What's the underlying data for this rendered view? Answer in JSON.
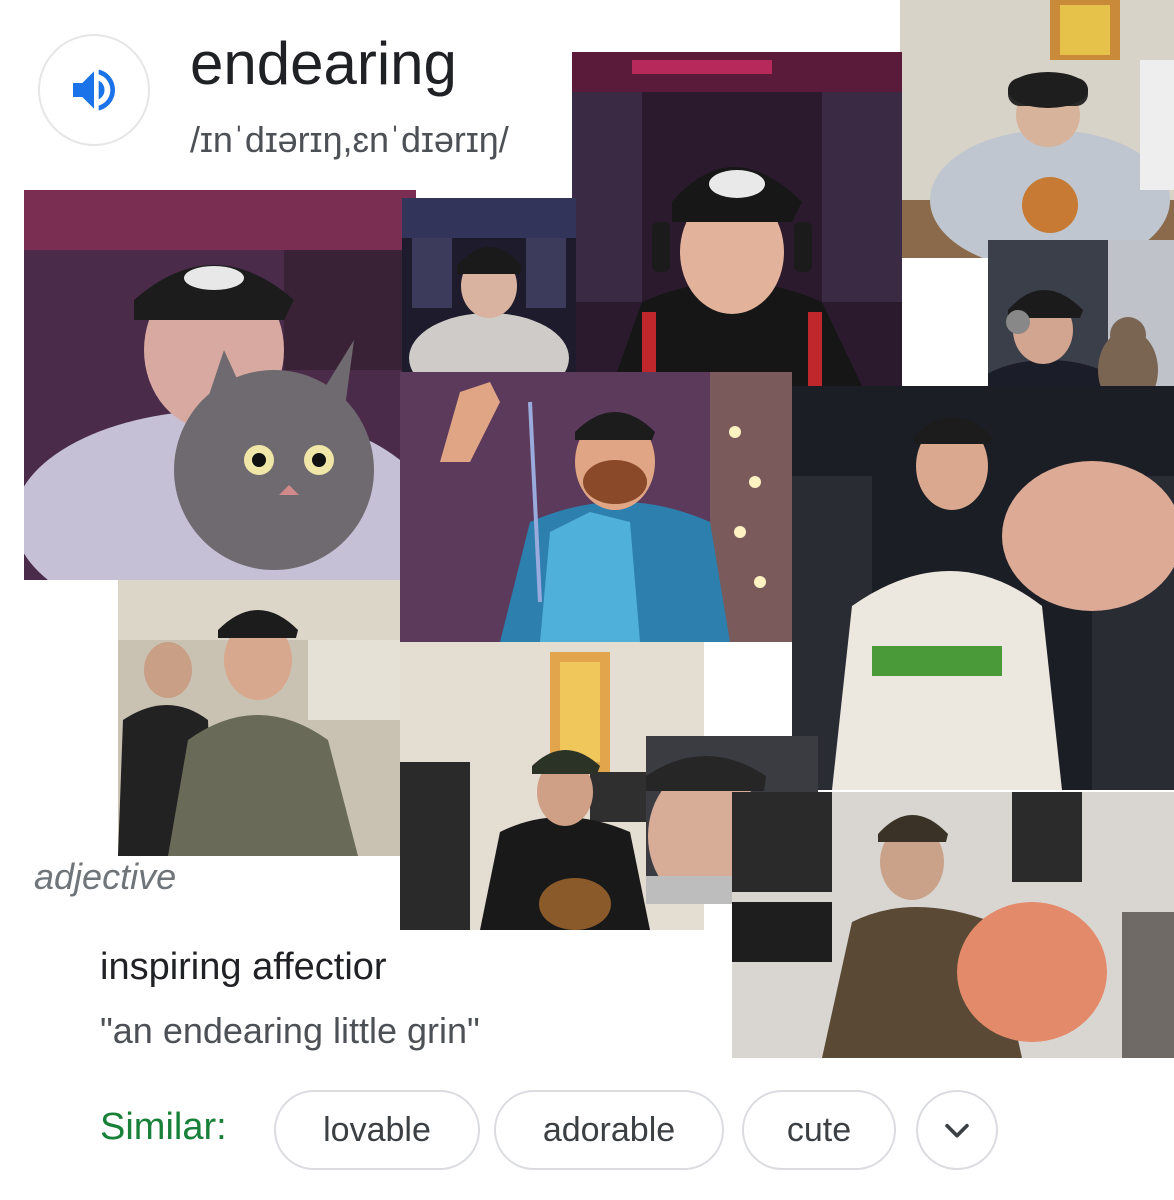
{
  "word": "endearing",
  "phonetic": "/ɪnˈdɪərɪŋ,ɛnˈdɪərɪŋ/",
  "part_of_speech": "adjective",
  "definition": "inspiring affectior",
  "example": "\"an endearing little grin\"",
  "similar": {
    "label": "Similar:",
    "chips": [
      "lovable",
      "adorable",
      "cute"
    ]
  },
  "icons": {
    "speaker": "speaker-icon",
    "expand": "chevron-down-icon"
  },
  "colors": {
    "speaker_blue": "#1a73e8",
    "similar_green": "#188038",
    "chip_border": "#dadce0"
  }
}
